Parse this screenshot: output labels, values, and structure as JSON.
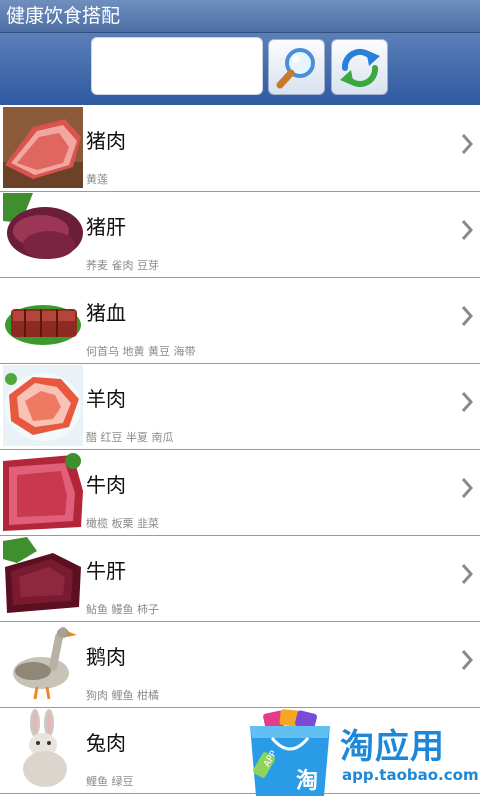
{
  "app": {
    "title": "健康饮食搭配"
  },
  "search": {
    "value": "",
    "placeholder": ""
  },
  "icons": {
    "search": "magnifier-icon",
    "refresh": "refresh-icon",
    "chevron": "chevron-right-icon"
  },
  "items": [
    {
      "name": "猪肉",
      "pairs": "黄莲"
    },
    {
      "name": "猪肝",
      "pairs": "荞麦 雀肉 豆芽"
    },
    {
      "name": "猪血",
      "pairs": "何首乌 地黄 黄豆 海带"
    },
    {
      "name": "羊肉",
      "pairs": "醋 红豆 半夏 南瓜"
    },
    {
      "name": "牛肉",
      "pairs": "橄榄 板栗 韭菜"
    },
    {
      "name": "牛肝",
      "pairs": "鲇鱼 鳗鱼 柿子"
    },
    {
      "name": "鹅肉",
      "pairs": "狗肉 鲤鱼 柑橘"
    },
    {
      "name": "兔肉",
      "pairs": "鲤鱼 绿豆"
    }
  ],
  "ad": {
    "brand": "淘应用",
    "url": "app.taobao.com",
    "badge": "APP",
    "bag_char": "淘"
  },
  "colors": {
    "header": "#4d6ea3",
    "accent": "#1e88d8"
  }
}
